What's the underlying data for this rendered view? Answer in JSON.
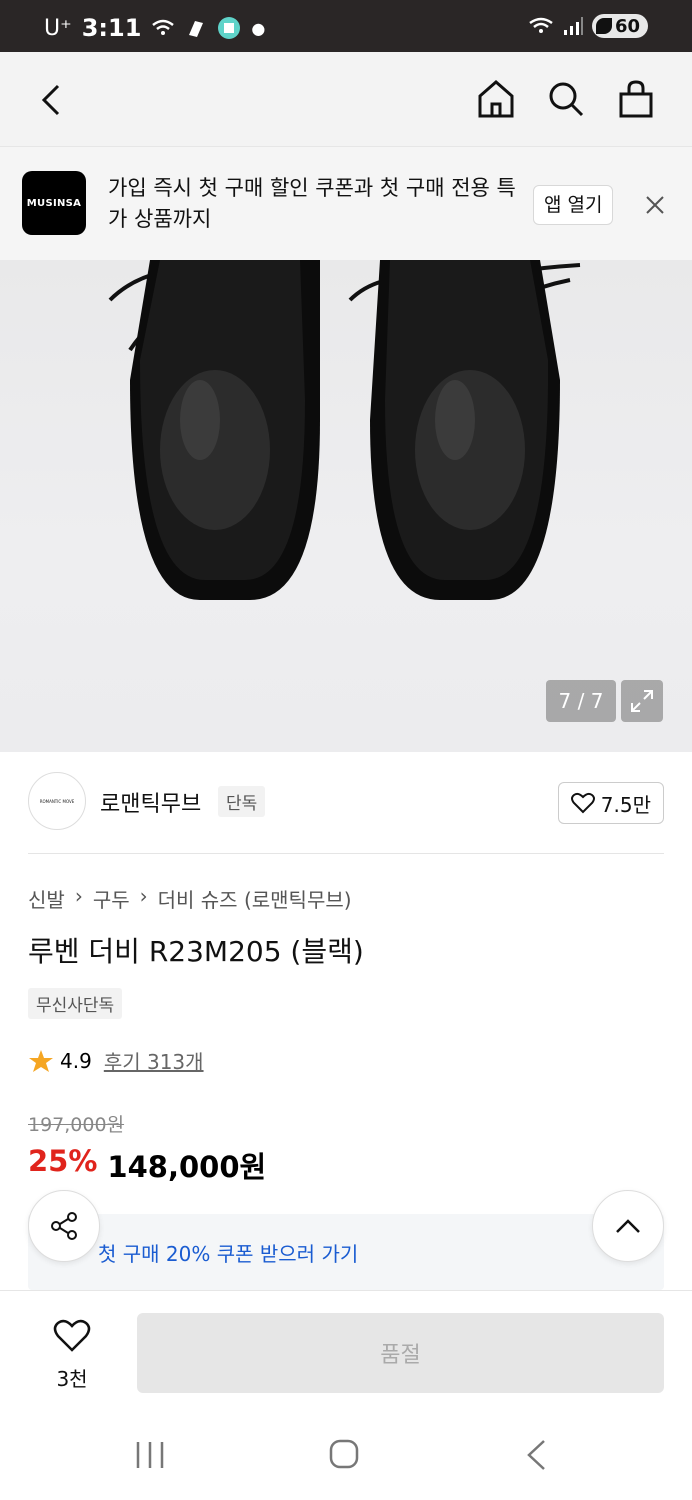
{
  "status_bar": {
    "carrier": "U⁺",
    "time": "3:11",
    "battery": "60"
  },
  "header": {
    "icons": [
      "back-icon",
      "home-icon",
      "search-icon",
      "cart-icon"
    ]
  },
  "promo": {
    "logo": "MUSINSA",
    "text": "가입 즉시 첫 구매 할인 쿠폰과 첫 구매 전용 특가 상품까지",
    "open_label": "앱 열기"
  },
  "image": {
    "counter": "7 / 7"
  },
  "brand": {
    "logo_text": "ROMANTIC MOVE",
    "name": "로맨틱무브",
    "badge": "단독",
    "likes": "7.5만"
  },
  "product": {
    "breadcrumb": [
      "신발",
      "구두",
      "더비 슈즈 (로맨틱무브)"
    ],
    "title": "루벤 더비 R23M205 (블랙)",
    "exclusive_badge": "무신사단독",
    "rating": "4.9",
    "reviews": "후기 313개",
    "original_price": "197,000원",
    "discount": "25%",
    "price": "148,000원",
    "coupon_text": "첫 구매 20% 쿠폰 받으러 가기"
  },
  "bottom": {
    "wish_count": "3천",
    "soldout_label": "품절"
  },
  "colors": {
    "discount": "#e0241c",
    "coupon_link": "#1a5cd1"
  }
}
